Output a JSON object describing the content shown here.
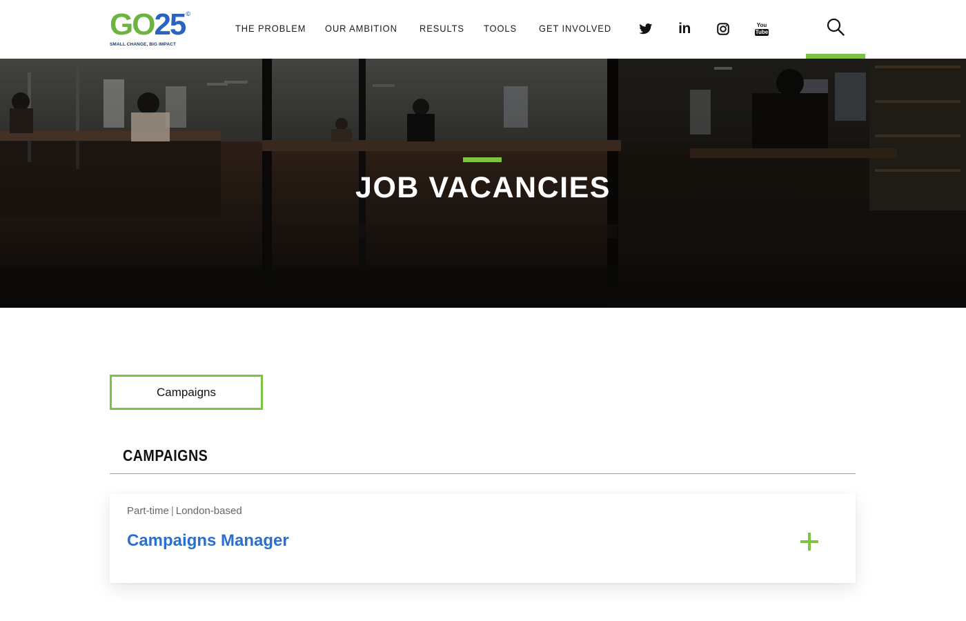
{
  "brand": {
    "logo_left": "GO",
    "logo_right": "25",
    "logo_mark": "©",
    "tagline": "SMALL CHANGE, BIG IMPACT",
    "green": "#7dc242",
    "blue": "#2a6fcf"
  },
  "nav": {
    "items": [
      {
        "label": "THE PROBLEM"
      },
      {
        "label": "OUR AMBITION"
      },
      {
        "label": "RESULTS"
      },
      {
        "label": "TOOLS"
      },
      {
        "label": "GET INVOLVED"
      }
    ]
  },
  "social": {
    "twitter": "twitter-icon",
    "linkedin": "linkedin-icon",
    "linkedin_text": "in",
    "instagram": "instagram-icon",
    "youtube": "youtube-icon",
    "youtube_text_top": "You",
    "youtube_text_bottom": "Tube"
  },
  "search": {
    "icon": "search-icon"
  },
  "hero": {
    "title": "JOB VACANCIES",
    "background": "office-photo"
  },
  "filter": {
    "selected": "Campaigns"
  },
  "section": {
    "title": "CAMPAIGNS"
  },
  "jobs": [
    {
      "type": "Part-time",
      "separator": "|",
      "location": "London-based",
      "title": "Campaigns Manager",
      "expand_icon": "plus-icon"
    }
  ]
}
